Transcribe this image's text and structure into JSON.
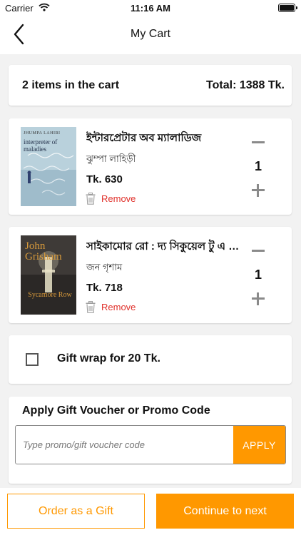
{
  "status_bar": {
    "carrier": "Carrier",
    "time": "11:16 AM"
  },
  "nav": {
    "title": "My Cart",
    "back_icon": "chevron-left-icon"
  },
  "cart_summary": {
    "count_text": "2 items in the cart",
    "total_text": "Total: 1388 Tk."
  },
  "items": [
    {
      "title": "ইন্টারপ্রেটার অব ম্যালাডিজ",
      "author": "ঝুম্পা লাহিড়ী",
      "price": "Tk. 630",
      "remove_label": "Remove",
      "quantity": "1",
      "cover": {
        "author_text": "JHUMPA LAHIRI",
        "title_text": "interpreter of maladies"
      }
    },
    {
      "title": "সাইকামোর রো : দ্য সিকুয়েল টু এ টাইম টু কিল",
      "author": "জন গৃশাম",
      "price": "Tk. 718",
      "remove_label": "Remove",
      "quantity": "1",
      "cover": {
        "author_text": "John Grisham",
        "title_text": "Sycamore Row"
      }
    }
  ],
  "gift_wrap": {
    "label": "Gift wrap for 20 Tk.",
    "checked": false
  },
  "promo": {
    "heading": "Apply Gift Voucher or Promo Code",
    "placeholder": "Type promo/gift voucher code",
    "value": "",
    "apply_label": "APPLY"
  },
  "actions": {
    "gift_label": "Order as a Gift",
    "next_label": "Continue to next"
  },
  "colors": {
    "accent": "#ff9800",
    "remove": "#e0312b",
    "background": "#f2f2f2"
  }
}
